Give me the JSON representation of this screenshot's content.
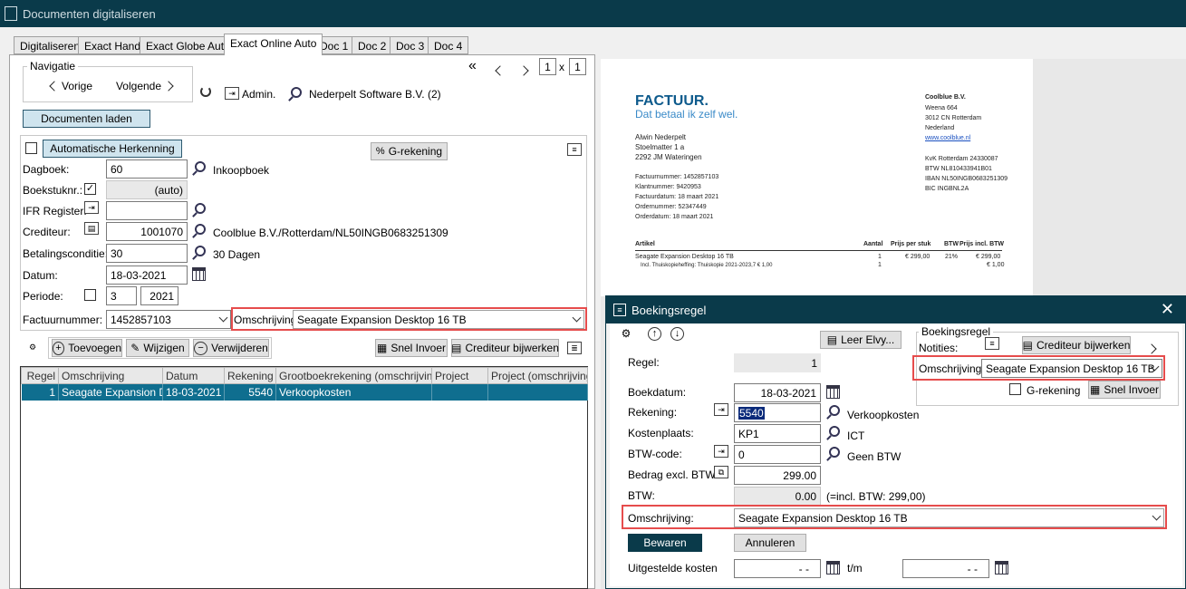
{
  "window": {
    "title": "Documenten digitaliseren"
  },
  "tabs": [
    "Digitaliseren",
    "Exact Hand",
    "Exact Globe Auto",
    "Exact Online Auto",
    "Doc 1",
    "Doc 2",
    "Doc 3",
    "Doc 4"
  ],
  "navigatie": {
    "group_label": "Navigatie",
    "prev": "Vorige",
    "next": "Volgende",
    "admin": "Admin.",
    "company": "Nederpelt Software B.V. (2)",
    "page": "1",
    "pages_sep": "x",
    "pages": "1"
  },
  "load_button": "Documenten laden",
  "form": {
    "auto_recognition": "Automatische Herkenning",
    "g_rekening": "G-rekening",
    "dagboek_label": "Dagboek:",
    "dagboek_value": "60",
    "dagboek_name": "Inkoopboek",
    "boekstuk_label": "Boekstuknr.:",
    "boekstuk_value": "(auto)",
    "ifr_label": "IFR Register:",
    "crediteur_label": "Crediteur:",
    "crediteur_value": "1001070",
    "crediteur_name": "Coolblue B.V./Rotterdam/NL50INGB0683251309",
    "betaling_label": "Betalingsconditie:",
    "betaling_value": "30",
    "betaling_name": "30 Dagen",
    "datum_label": "Datum:",
    "datum_value": "18-03-2021",
    "periode_label": "Periode:",
    "periode_value": "3",
    "periode_year": "2021",
    "factuur_label": "Factuurnummer:",
    "factuur_value": "1452857103",
    "omschrijving_label": "Omschrijving:",
    "omschrijving_value": "Seagate Expansion Desktop 16 TB"
  },
  "toolbar": {
    "add": "Toevoegen",
    "edit": "Wijzigen",
    "delete": "Verwijderen",
    "quick": "Snel Invoer",
    "update_cred": "Crediteur bijwerken"
  },
  "grid": {
    "headers": [
      "Regel",
      "Omschrijving",
      "Datum",
      "Rekening",
      "Grootboekrekening (omschrijving)",
      "Project",
      "Project (omschrijving)"
    ],
    "rows": [
      [
        "1",
        "Seagate Expansion De",
        "18-03-2021",
        "5540",
        "Verkoopkosten",
        "",
        ""
      ]
    ]
  },
  "invoice": {
    "logo": "FACTUUR.",
    "tagline": "Dat betaal ik zelf wel.",
    "customer": [
      "Alwin Nederpelt",
      "Stoelmatter 1 a",
      "2292 JM  Wateringen"
    ],
    "vendor": [
      "Coolblue B.V.",
      "Weena 664",
      "3012 CN  Rotterdam",
      "Nederland",
      "www.coolblue.nl"
    ],
    "vendor_ids": [
      "KvK Rotterdam 24330087",
      "BTW NL810433941B01",
      "IBAN NL50INGB0683251309",
      "BIC INGBNL2A"
    ],
    "meta": [
      "Factuurnummer: 1452857103",
      "Klantnummer: 9420953",
      "Factuurdatum: 18 maart 2021",
      "Ordernummer: 52347449",
      "Orderdatum: 18 maart 2021"
    ],
    "headers": [
      "Artikel",
      "Aantal",
      "Prijs per stuk",
      "BTW",
      "Prijs incl. BTW"
    ],
    "line1": [
      "Seagate Expansion Desktop 16 TB",
      "1",
      "€ 299,00",
      "21%",
      "€ 299,00"
    ],
    "line2": [
      "Incl. Thuiskopieheffing: Thuiskopie 2021-2023,7 € 1,00",
      "1",
      "",
      "",
      "€ 1,00"
    ]
  },
  "dialog": {
    "title": "Boekingsregel",
    "leer": "Leer Elvy...",
    "group_label": "Boekingsregel",
    "notities": "Notities:",
    "update_cred": "Crediteur bijwerken",
    "omschrijving_label": "Omschrijving:",
    "omschrijving_value": "Seagate Expansion Desktop 16 TB",
    "g_rekening": "G-rekening",
    "quick": "Snel Invoer",
    "regel_label": "Regel:",
    "regel_value": "1",
    "boekdatum_label": "Boekdatum:",
    "boekdatum_value": "18-03-2021",
    "rekening_label": "Rekening:",
    "rekening_value": "5540",
    "rekening_name": "Verkoopkosten",
    "kostenplaats_label": "Kostenplaats:",
    "kostenplaats_value": "KP1",
    "kostenplaats_name": "ICT",
    "btwcode_label": "BTW-code:",
    "btwcode_value": "0",
    "btwcode_name": "Geen BTW",
    "bedrag_label": "Bedrag excl. BTW:",
    "bedrag_value": "299.00",
    "btw_label": "BTW:",
    "btw_value": "0.00",
    "btw_incl": "(=incl. BTW: 299,00)",
    "omschr2_label": "Omschrijving:",
    "omschr2_value": "Seagate Expansion Desktop 16 TB",
    "save": "Bewaren",
    "cancel": "Annuleren",
    "uitgesteld_label": "Uitgestelde kosten",
    "date_empty": "- -",
    "tm": "t/m"
  }
}
